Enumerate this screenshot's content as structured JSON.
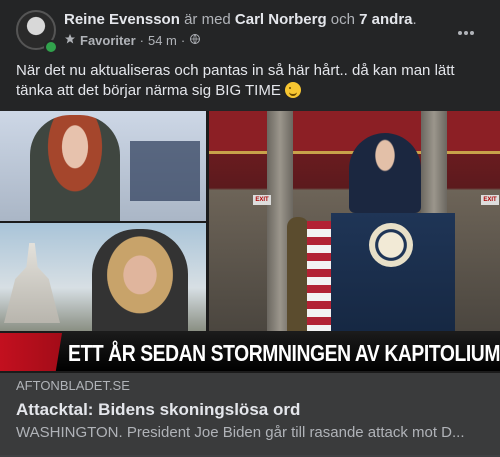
{
  "post": {
    "author": "Reine Evensson",
    "with_text": "är med",
    "tagged": "Carl Norberg",
    "and_text": "och",
    "others": "7 andra",
    "period": ".",
    "audience": "Favoriter",
    "dot": "·",
    "time": "54 m",
    "dot2": "·",
    "text": "När det nu aktualiseras och pantas in så här hårt.. då kan man lätt tänka att det börjar närma sig BIG TIME",
    "more_icon": "more-horizontal-icon"
  },
  "media": {
    "banner_text": "ETT ÅR SEDAN STORMNINGEN AV KAPITOLIUM",
    "exit_sign": "EXIT",
    "accent_red": "#c3101f"
  },
  "link_preview": {
    "domain": "AFTONBLADET.SE",
    "title": "Attacktal: Bidens skoningslösa ord",
    "description": "WASHINGTON. President Joe Biden går till rasande attack mot D..."
  }
}
